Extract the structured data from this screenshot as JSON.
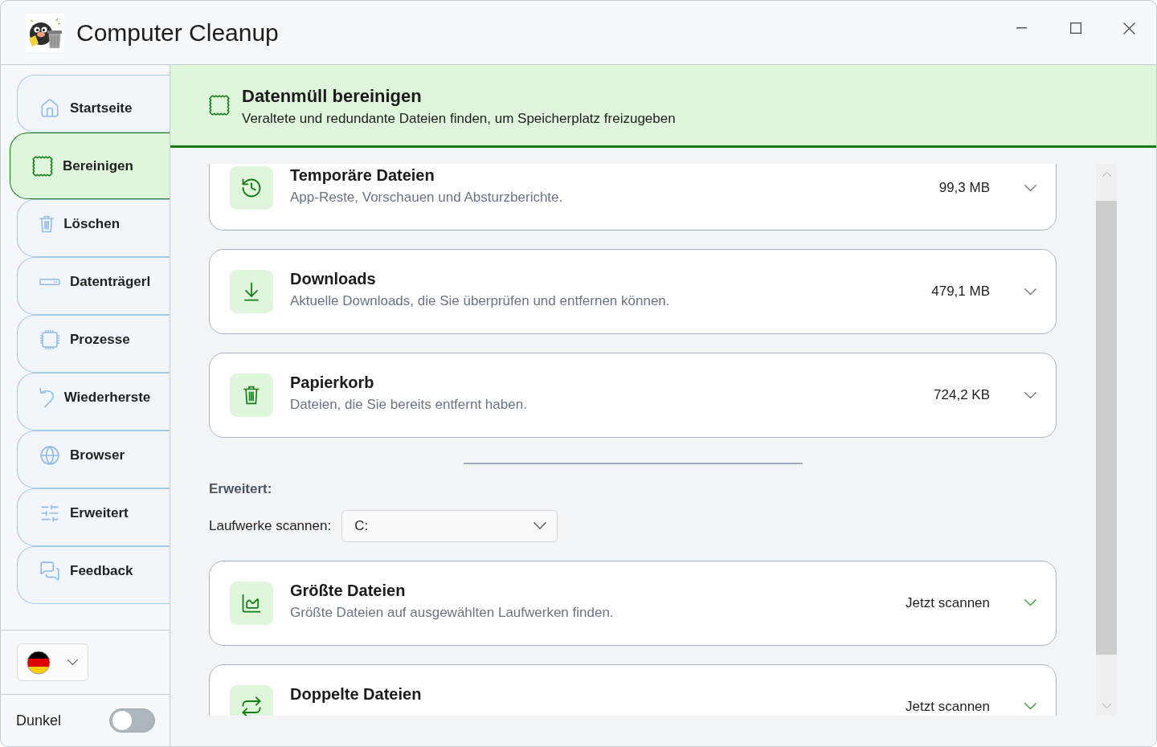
{
  "window": {
    "title": "Computer Cleanup"
  },
  "sidebar": {
    "items": [
      {
        "label": "Startseite",
        "selected": false
      },
      {
        "label": "Bereinigen",
        "selected": true
      },
      {
        "label": "Löschen",
        "selected": false
      },
      {
        "label": "Datenträgerl",
        "selected": false
      },
      {
        "label": "Prozesse",
        "selected": false
      },
      {
        "label": "Wiederherste",
        "selected": false
      },
      {
        "label": "Browser",
        "selected": false
      },
      {
        "label": "Erweitert",
        "selected": false
      },
      {
        "label": "Feedback",
        "selected": false
      }
    ],
    "dark_mode": {
      "label": "Dunkel",
      "on": false
    }
  },
  "header": {
    "title": "Datenmüll bereinigen",
    "subtitle": "Veraltete und redundante Dateien finden, um Speicherplatz freizugeben"
  },
  "categories": [
    {
      "title": "Temporäre Dateien",
      "description": "App-Reste, Vorschauen und Absturzberichte.",
      "size": "99,3 MB",
      "expanded": false
    },
    {
      "title": "Downloads",
      "description": "Aktuelle Downloads, die Sie überprüfen und entfernen können.",
      "size": "479,1 MB",
      "expanded": false
    },
    {
      "title": "Papierkorb",
      "description": "Dateien, die Sie bereits entfernt haben.",
      "size": "724,2 KB",
      "expanded": false
    }
  ],
  "advanced": {
    "heading": "Erweitert:",
    "drive_select": {
      "label": "Laufwerke scannen:",
      "value": "C:"
    },
    "cards": [
      {
        "title": "Größte Dateien",
        "description": "Größte Dateien auf ausgewählten Laufwerken finden.",
        "action": "Jetzt scannen",
        "expanded": false
      },
      {
        "title": "Doppelte Dateien",
        "action": "Jetzt scannen",
        "expanded": false
      }
    ]
  }
}
